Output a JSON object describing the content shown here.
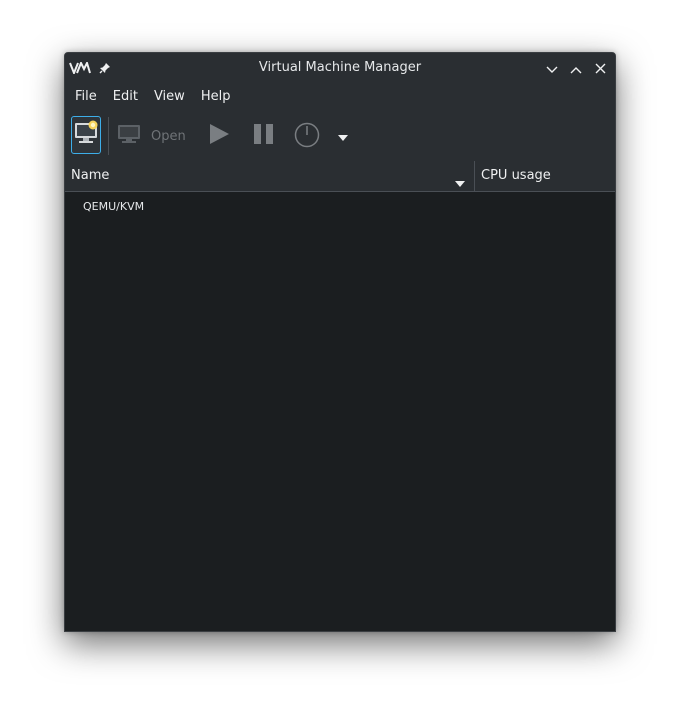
{
  "window": {
    "title": "Virtual Machine Manager"
  },
  "titlebar": {
    "app_icon": "vm-logo-icon",
    "pin_icon": "pin-icon",
    "controls": [
      "minimize-icon",
      "maximize-icon",
      "close-icon"
    ]
  },
  "menubar": {
    "items": [
      "File",
      "Edit",
      "View",
      "Help"
    ]
  },
  "toolbar": {
    "new_vm_icon": "new-vm-icon",
    "open_label": "Open",
    "run_icon": "play-icon",
    "pause_icon": "pause-icon",
    "shutdown_icon": "power-icon",
    "shutdown_menu_icon": "dropdown-arrow-icon"
  },
  "table": {
    "columns": [
      "Name",
      "CPU usage"
    ],
    "rows": [
      "QEMU/KVM"
    ]
  },
  "colors": {
    "background": "#1b1e20",
    "chrome": "#2a2e32",
    "accent": "#3daee9",
    "text": "#eff0f1",
    "disabled": "#6f7377"
  }
}
